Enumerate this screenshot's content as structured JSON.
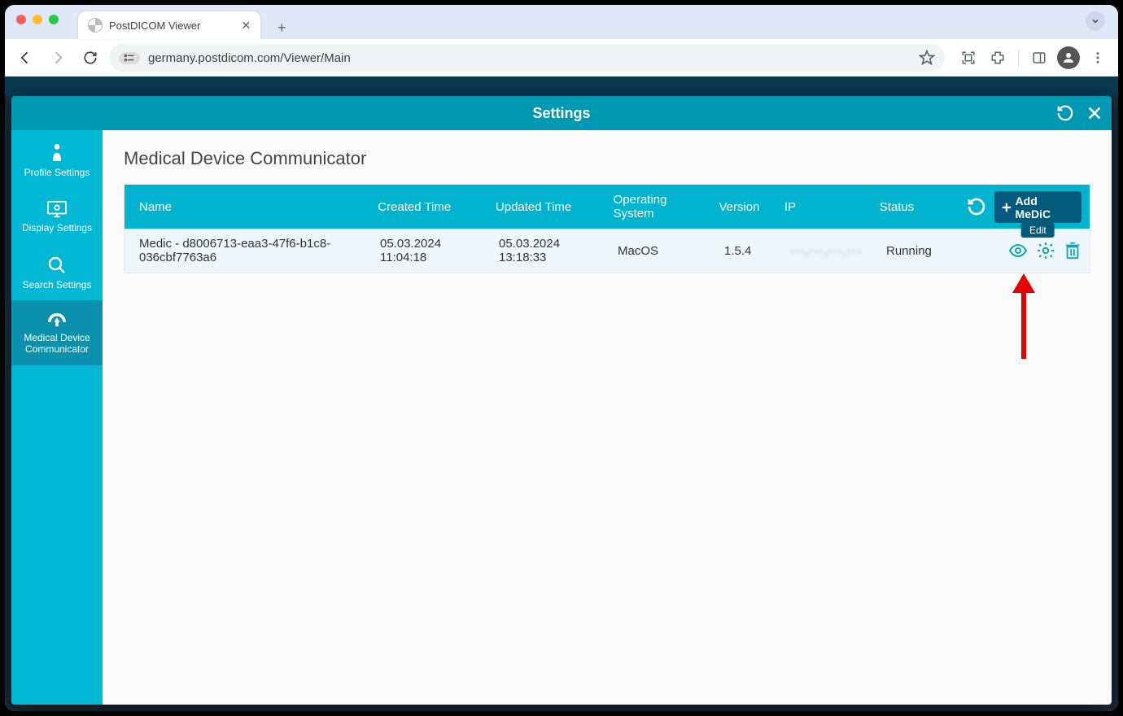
{
  "browser": {
    "tab_title": "PostDICOM Viewer",
    "url": "germany.postdicom.com/Viewer/Main"
  },
  "modal": {
    "title": "Settings",
    "page_title": "Medical Device Communicator",
    "sidenav": [
      {
        "label": "Profile Settings"
      },
      {
        "label": "Display Settings"
      },
      {
        "label": "Search Settings"
      },
      {
        "label": "Medical Device Communicator"
      }
    ],
    "columns": {
      "name": "Name",
      "created": "Created Time",
      "updated": "Updated Time",
      "os": "Operating System",
      "version": "Version",
      "ip": "IP",
      "status": "Status"
    },
    "add_label": "Add MeDiC",
    "edit_tooltip": "Edit",
    "rows": [
      {
        "name": "Medic - d8006713-eaa3-47f6-b1c8-036cbf7763a6",
        "created": "05.03.2024 11:04:18",
        "updated": "05.03.2024 13:18:33",
        "os": "MacOS",
        "version": "1.5.4",
        "ip": "···.···.···.···",
        "status": "Running"
      }
    ]
  }
}
